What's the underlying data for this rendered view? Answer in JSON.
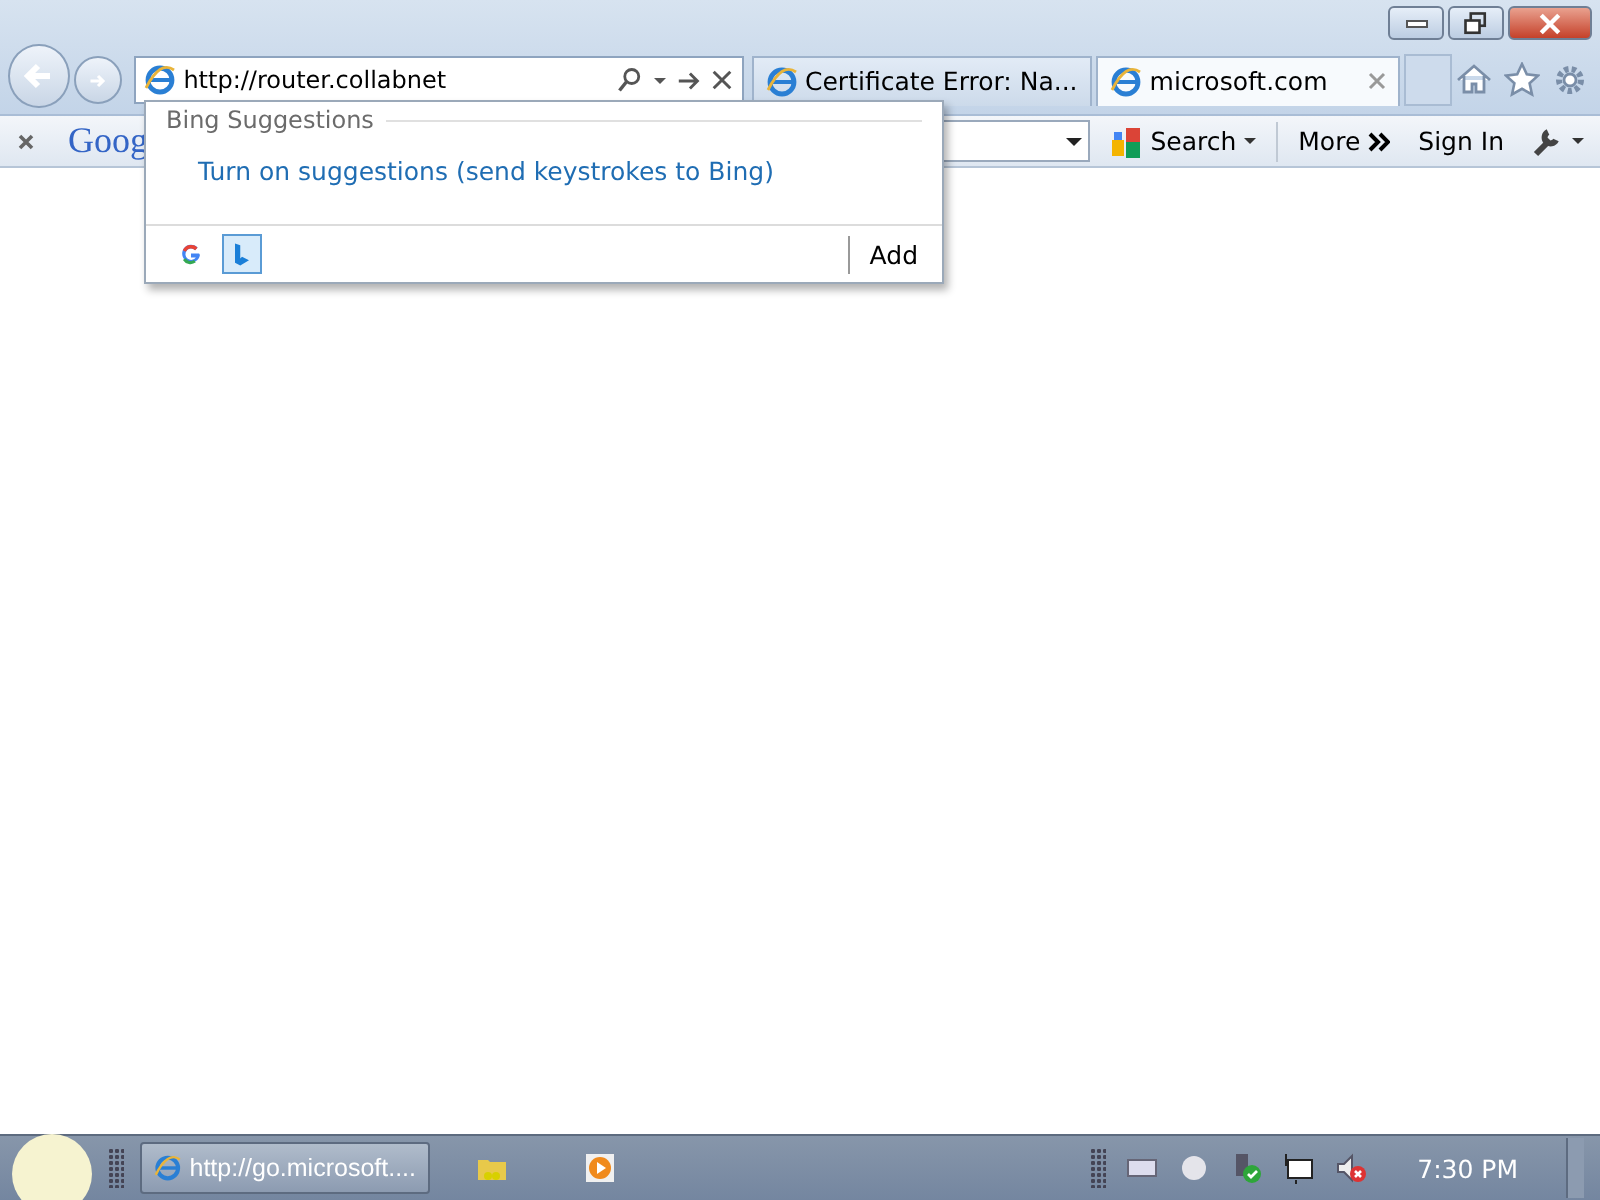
{
  "address": {
    "value": "http://router.collabnet"
  },
  "tabs": [
    {
      "label": "Certificate Error: Na...",
      "selected": false
    },
    {
      "label": "microsoft.com",
      "selected": true
    }
  ],
  "toolbar": {
    "logo": "Goog",
    "search": "Search",
    "more": "More",
    "sign_in": "Sign In"
  },
  "suggestions": {
    "heading": "Bing Suggestions",
    "link": "Turn on suggestions (send keystrokes to Bing)",
    "providers": [
      {
        "kind": "google",
        "selected": false
      },
      {
        "kind": "bing",
        "selected": true
      }
    ],
    "add": "Add"
  },
  "taskbar": {
    "items": [
      {
        "kind": "browser",
        "label": "http://go.microsoft....",
        "selected": true
      },
      {
        "kind": "folder",
        "selected": false
      },
      {
        "kind": "media",
        "selected": false
      }
    ],
    "clock": "7:30 PM"
  }
}
